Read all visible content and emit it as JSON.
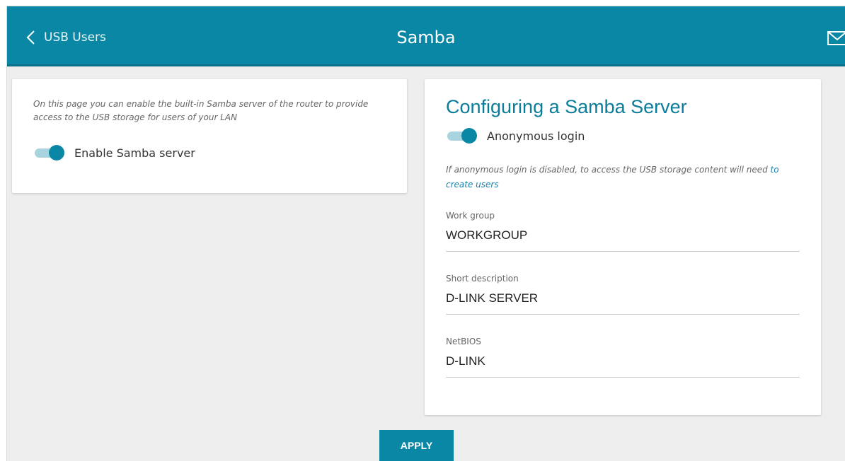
{
  "header": {
    "back_label": "USB Users",
    "title": "Samba",
    "accent_color": "#0b87a6"
  },
  "left_card": {
    "description": "On this page you can enable the built-in Samba server of the router to provide access to the USB storage for users of your LAN",
    "enable_toggle": {
      "label": "Enable Samba server",
      "checked": true
    }
  },
  "right_card": {
    "title": "Configuring a Samba Server",
    "anonymous_toggle": {
      "label": "Anonymous login",
      "checked": true
    },
    "info_text": "If anonymous login is disabled, to access the USB storage content will need ",
    "info_link": "to create users",
    "fields": [
      {
        "label": "Work group",
        "value": "WORKGROUP"
      },
      {
        "label": "Short description",
        "value": "D-LINK SERVER"
      },
      {
        "label": "NetBIOS",
        "value": "D-LINK"
      }
    ]
  },
  "footer": {
    "apply_label": "APPLY"
  },
  "icons": {
    "back": "chevron-left-icon",
    "mail": "envelope-icon"
  }
}
